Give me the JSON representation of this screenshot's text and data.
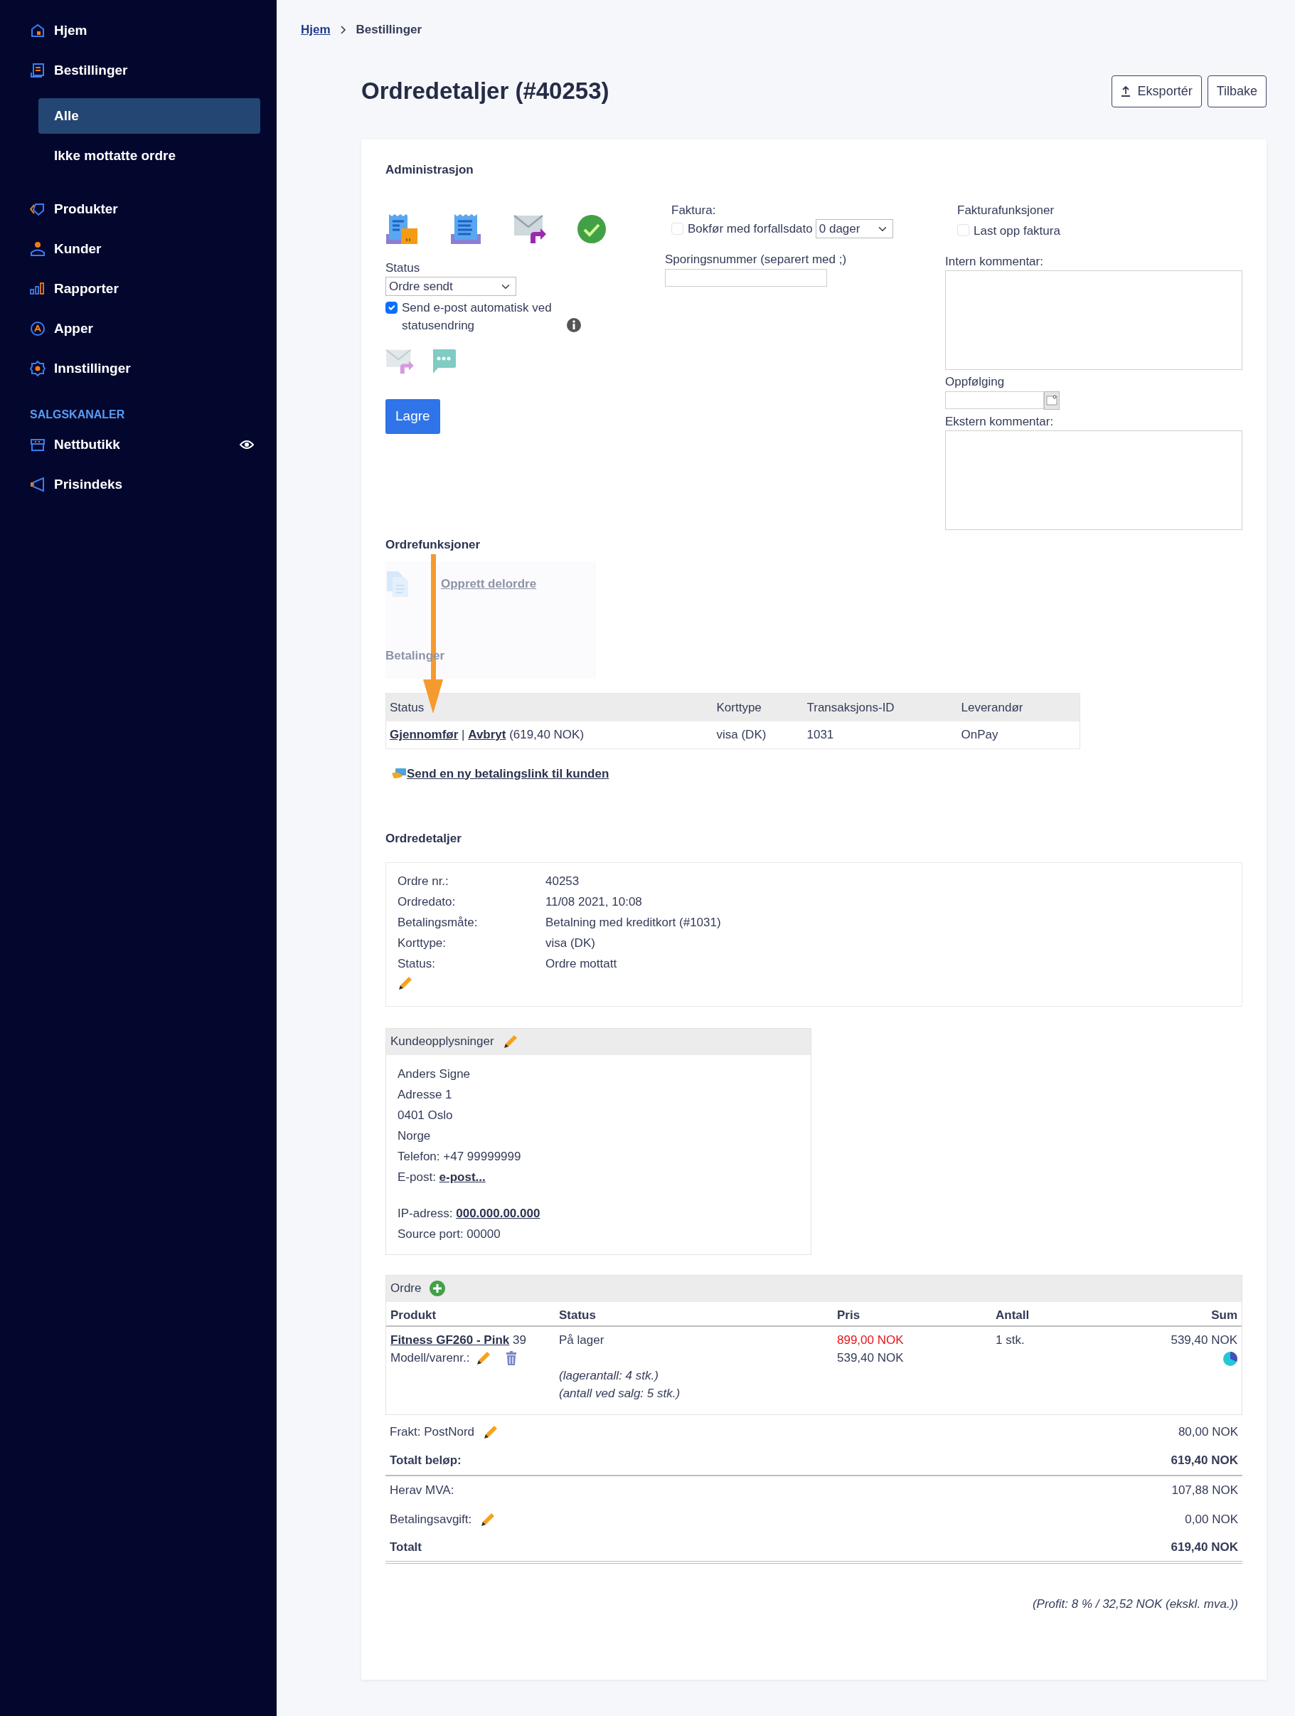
{
  "sidebar": {
    "items": [
      {
        "label": "Hjem",
        "selected": false
      },
      {
        "label": "Bestillinger",
        "selected": false,
        "children": [
          {
            "label": "Alle",
            "selected": true
          },
          {
            "label": "Ikke mottatte ordre",
            "selected": false
          }
        ]
      },
      {
        "label": "Produkter",
        "selected": false
      },
      {
        "label": "Kunder",
        "selected": false
      },
      {
        "label": "Rapporter",
        "selected": false
      },
      {
        "label": "Apper",
        "selected": false
      },
      {
        "label": "Innstillinger",
        "selected": false
      }
    ],
    "section_label": "SALGSKANALER",
    "channels": [
      {
        "label": "Nettbutikk",
        "selected": false,
        "visible": true
      },
      {
        "label": "Prisindeks",
        "selected": false,
        "visible": false
      }
    ]
  },
  "breadcrumb": [
    "Hjem",
    "Bestillinger"
  ],
  "title": "Ordredetaljer (#40253)",
  "header_buttons": [
    "Eksportér",
    "Tilbake"
  ],
  "administration": {
    "heading": "Administrasjon",
    "status_label": "Status",
    "status_value": "Ordre sendt",
    "auto_email": {
      "label": "Send e-post automatisk ved statusendring",
      "checked": true
    },
    "save_button": "Lagre",
    "invoice_label": "Faktura:",
    "due_date": {
      "label": "Bokfør med forfallsdato",
      "checked": false
    },
    "days_value": "0 dager",
    "tracking_label": "Sporingsnummer (separert med ;)",
    "invoice_functions_label": "Fakturafunksjoner",
    "upload_invoice": {
      "label": "Last opp faktura",
      "checked": false
    },
    "internal_comment_label": "Intern kommentar:",
    "followup_label": "Oppfølging",
    "external_comment_label": "Ekstern kommentar:"
  },
  "order_functions": {
    "heading": "Ordrefunksjoner",
    "dimmed": true,
    "create_suborder": "Opprett delordre",
    "payments_heading": "Betalinger"
  },
  "annotation_arrow": true,
  "payments": {
    "columns": [
      "Status",
      "Korttype",
      "Transaksjons-ID",
      "Leverandør"
    ],
    "rows": [
      {
        "actions": [
          "Gjennomfør",
          "Avbryt"
        ],
        "separator": "|",
        "amount": "(619,40 NOK)",
        "card_type": "visa (DK)",
        "transaction_id": "1031",
        "provider": "OnPay"
      }
    ],
    "payment_link": "Send en ny betalingslink til kunden"
  },
  "order_details": {
    "heading": "Ordredetaljer",
    "fields": [
      {
        "label": "Ordre nr.:",
        "value": "40253"
      },
      {
        "label": "Ordredato:",
        "value": "11/08 2021, 10:08"
      },
      {
        "label": "Betalingsmåte:",
        "value": "Betalning med kreditkort (#1031)"
      },
      {
        "label": "Korttype:",
        "value": "visa (DK)"
      },
      {
        "label": "Status:",
        "value": "Ordre mottatt"
      }
    ]
  },
  "customer": {
    "heading": "Kundeopplysninger",
    "lines": [
      {
        "kind": "text",
        "text": "Anders Signe"
      },
      {
        "kind": "text",
        "text": "Adresse 1"
      },
      {
        "kind": "text",
        "text": "0401 Oslo"
      },
      {
        "kind": "text",
        "text": "Norge"
      },
      {
        "kind": "text",
        "text": "Telefon: +47 99999999"
      },
      {
        "kind": "link",
        "label": "E-post:",
        "link": "e-post..."
      },
      {
        "kind": "gap"
      },
      {
        "kind": "link",
        "label": "IP-adress:",
        "link": "000.000.00.000"
      },
      {
        "kind": "text",
        "text": "Source port: 00000"
      }
    ]
  },
  "order": {
    "heading": "Ordre",
    "columns": [
      "Produkt",
      "Status",
      "Pris",
      "Antall",
      "Sum"
    ],
    "items": [
      {
        "product": "Fitness GF260 - Pink",
        "number": "39",
        "model_label": "Modell/varenr.:",
        "status": "På lager",
        "notes": [
          "(lagerantall: 4 stk.)",
          "(antall ved salg: 5 stk.)"
        ],
        "list_price": "899,00 NOK",
        "price": "539,40 NOK",
        "quantity": "1 stk.",
        "sum": "539,40 NOK"
      }
    ],
    "summary": [
      {
        "kind": "normal",
        "label": "Frakt: PostNord",
        "editable": true,
        "value": "80,00 NOK"
      },
      {
        "kind": "subtotal",
        "label": "Totalt beløp:",
        "editable": false,
        "value": "619,40 NOK"
      },
      {
        "kind": "normal",
        "label": "Herav MVA:",
        "editable": false,
        "value": "107,88 NOK"
      },
      {
        "kind": "normal",
        "label": "Betalingsavgift:",
        "editable": true,
        "value": "0,00 NOK"
      },
      {
        "kind": "total",
        "label": "Totalt",
        "editable": false,
        "value": "619,40 NOK"
      }
    ],
    "profit": "(Profit: 8 % / 32,52 NOK (ekskl. mva.))"
  }
}
